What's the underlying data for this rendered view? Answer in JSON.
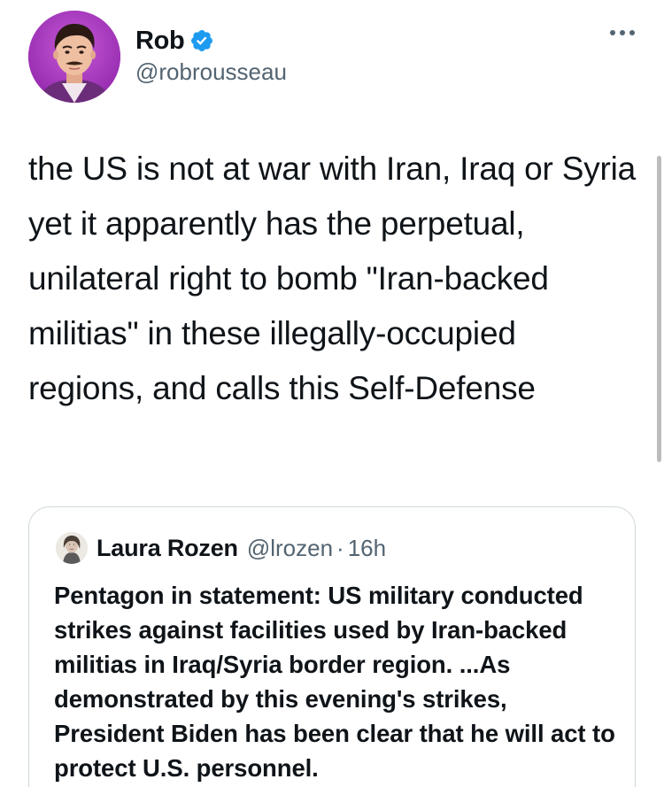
{
  "tweet": {
    "author": {
      "display_name": "Rob",
      "handle": "@robrousseau",
      "verified": true
    },
    "text": "the US is not at war with Iran, Iraq or Syria yet it apparently has the perpetual, unilateral right to bomb \"Iran-backed militias\" in these illegally-occupied regions, and calls this Self-Defense",
    "more_icon": "more-horizontal-icon"
  },
  "quoted_tweet": {
    "author": {
      "display_name": "Laura Rozen",
      "handle": "@lrozen",
      "separator": "·",
      "time": "16h"
    },
    "text": "Pentagon in statement: US military conducted strikes against facilities used by Iran-backed militias in Iraq/Syria border region. ...As demonstrated by this evening's strikes, President Biden has been clear that he will act to protect U.S. personnel."
  },
  "colors": {
    "text_primary": "#0f1419",
    "text_secondary": "#536471",
    "verified_blue": "#1d9bf0",
    "card_border": "#cfd9de",
    "avatar_bg": "#b33dc6"
  }
}
